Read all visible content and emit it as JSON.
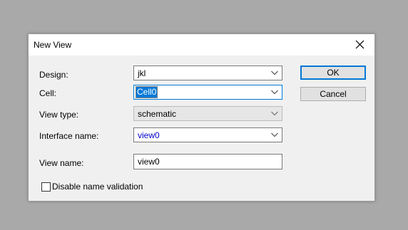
{
  "dialog": {
    "title": "New View",
    "close_icon": "close-icon"
  },
  "form": {
    "design": {
      "label": "Design:",
      "value": "jkl"
    },
    "cell": {
      "label": "Cell:",
      "value": "Cell0"
    },
    "view_type": {
      "label": "View type:",
      "value": "schematic"
    },
    "interface_name": {
      "label": "Interface name:",
      "value": "view0"
    },
    "view_name": {
      "label": "View name:",
      "value": "view0"
    }
  },
  "buttons": {
    "ok": "OK",
    "cancel": "Cancel"
  },
  "options": {
    "disable_validation_label": "Disable name validation",
    "disable_validation_checked": false
  },
  "colors": {
    "accent": "#0078d7",
    "interface_text": "#0000cc"
  }
}
